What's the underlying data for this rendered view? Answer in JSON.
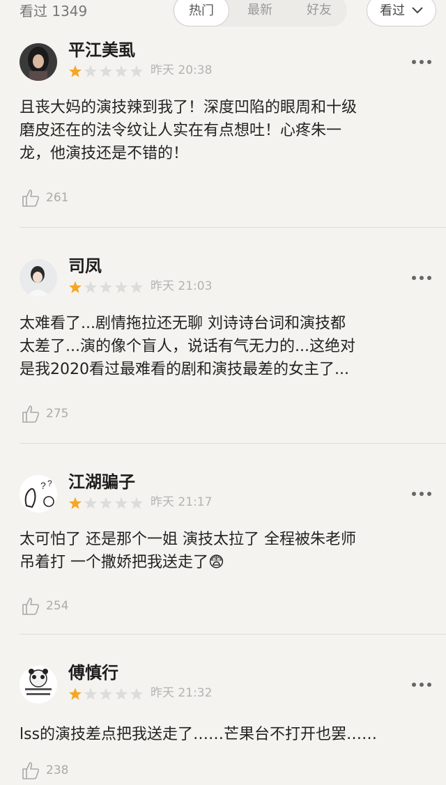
{
  "header": {
    "seen_count": "看过 1349",
    "tabs": [
      {
        "label": "热门",
        "active": true
      },
      {
        "label": "最新",
        "active": false
      },
      {
        "label": "好友",
        "active": false
      }
    ],
    "sort_label": "看过"
  },
  "colors": {
    "star_filled": "#f5a623",
    "star_empty": "#dcdcdc",
    "like_icon": "#a8a8a8"
  },
  "comments": [
    {
      "username": "平江美虱",
      "rating": 1,
      "max_rating": 5,
      "time": "昨天 20:38",
      "text": "且丧大妈的演技辣到我了！深度凹陷的眼周和十级\n磨皮还在的法令纹让人实在有点想吐！心疼朱一\n龙，他演技还是不错的！",
      "likes": "261"
    },
    {
      "username": "司凤",
      "rating": 1,
      "max_rating": 5,
      "time": "昨天 21:03",
      "text": "太难看了...剧情拖拉还无聊 刘诗诗台词和演技都\n太差了...演的像个盲人，说话有气无力的...这绝对\n是我2020看过最难看的剧和演技最差的女主了...",
      "likes": "275"
    },
    {
      "username": "江湖骗子",
      "rating": 1,
      "max_rating": 5,
      "time": "昨天 21:17",
      "text": "太可怕了 还是那个一姐 演技太拉了 全程被朱老师\n吊着打 一个撒娇把我送走了",
      "emoji": "😨",
      "likes": "254"
    },
    {
      "username": "傅慎行",
      "rating": 1,
      "max_rating": 5,
      "time": "昨天 21:32",
      "text": "lss的演技差点把我送走了……芒果台不打开也罢……",
      "likes": "238"
    }
  ]
}
